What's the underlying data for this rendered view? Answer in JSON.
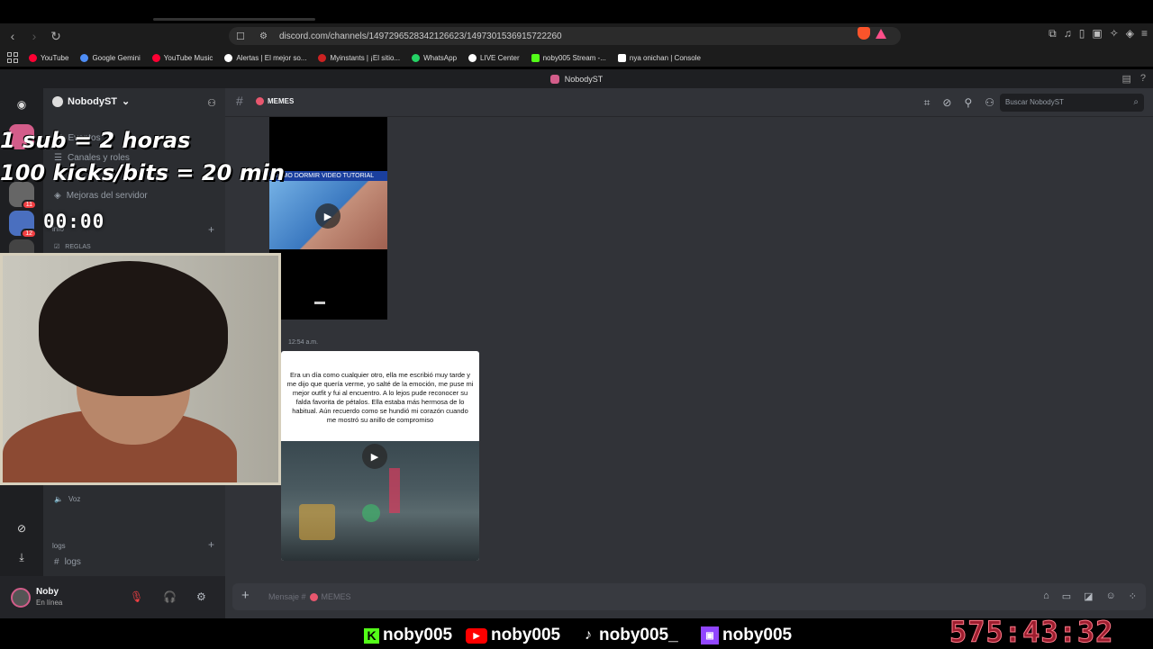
{
  "browser": {
    "url": "discord.com/channels/1497296528342126623/1497301536915722260",
    "bookmarks": [
      {
        "label": "YouTube",
        "color": "#ff0033"
      },
      {
        "label": "Google Gemini",
        "color": "#4e8df5"
      },
      {
        "label": "YouTube Music",
        "color": "#ff0033"
      },
      {
        "label": "Alertas | El mejor so...",
        "color": "#ffffff"
      },
      {
        "label": "Myinstants | ¡El sitio...",
        "color": "#cc2222"
      },
      {
        "label": "WhatsApp",
        "color": "#25d366"
      },
      {
        "label": "LIVE Center",
        "color": "#ffffff"
      },
      {
        "label": "noby005 Stream -...",
        "color": "#53fc18"
      },
      {
        "label": "nya onichan | Console",
        "color": "#ffffff"
      }
    ]
  },
  "discord": {
    "window_title": "NobodyST",
    "server_name": "NobodyST",
    "channel_name": "MEMES",
    "search_placeholder": "Buscar NobodyST",
    "sidebar": {
      "events": "Eventos",
      "channels_roles": "Canales y roles",
      "boosts": "Mejoras del servidor",
      "category_info": "info",
      "rules": "REGLAS",
      "voice": "Voz",
      "category_logs": "logs",
      "logs_channel": "logs"
    },
    "guild_badges": [
      "11",
      "12"
    ],
    "user": {
      "name": "Noby",
      "status": "En línea"
    },
    "message_time": "12:54 a.m.",
    "video1_title": "COMO DORMIR VIDEO TUTORIAL",
    "meme_text": "Era un día como cualquier otro, ella me escribió muy tarde y me dijo que quería verme, yo salté de la emoción, me puse mi mejor outfit y fui al encuentro. A lo lejos pude reconocer su falda favorita de pétalos. Ella estaba más hermosa de lo habitual. Aún recuerdo como se hundió mi corazón cuando me mostró su anillo de compromiso",
    "composer_placeholder": "Mensaje #",
    "composer_channel": "MEMES"
  },
  "stream_overlay": {
    "line1": "1 sub = 2 horas",
    "line2": "100 kicks/bits = 20 min",
    "small_timer": "00:00",
    "big_timer": "575:43:32",
    "socials": [
      {
        "platform": "kick",
        "handle": "noby005"
      },
      {
        "platform": "youtube",
        "handle": "noby005"
      },
      {
        "platform": "tiktok",
        "handle": "noby005_"
      },
      {
        "platform": "twitch",
        "handle": "noby005"
      }
    ]
  }
}
